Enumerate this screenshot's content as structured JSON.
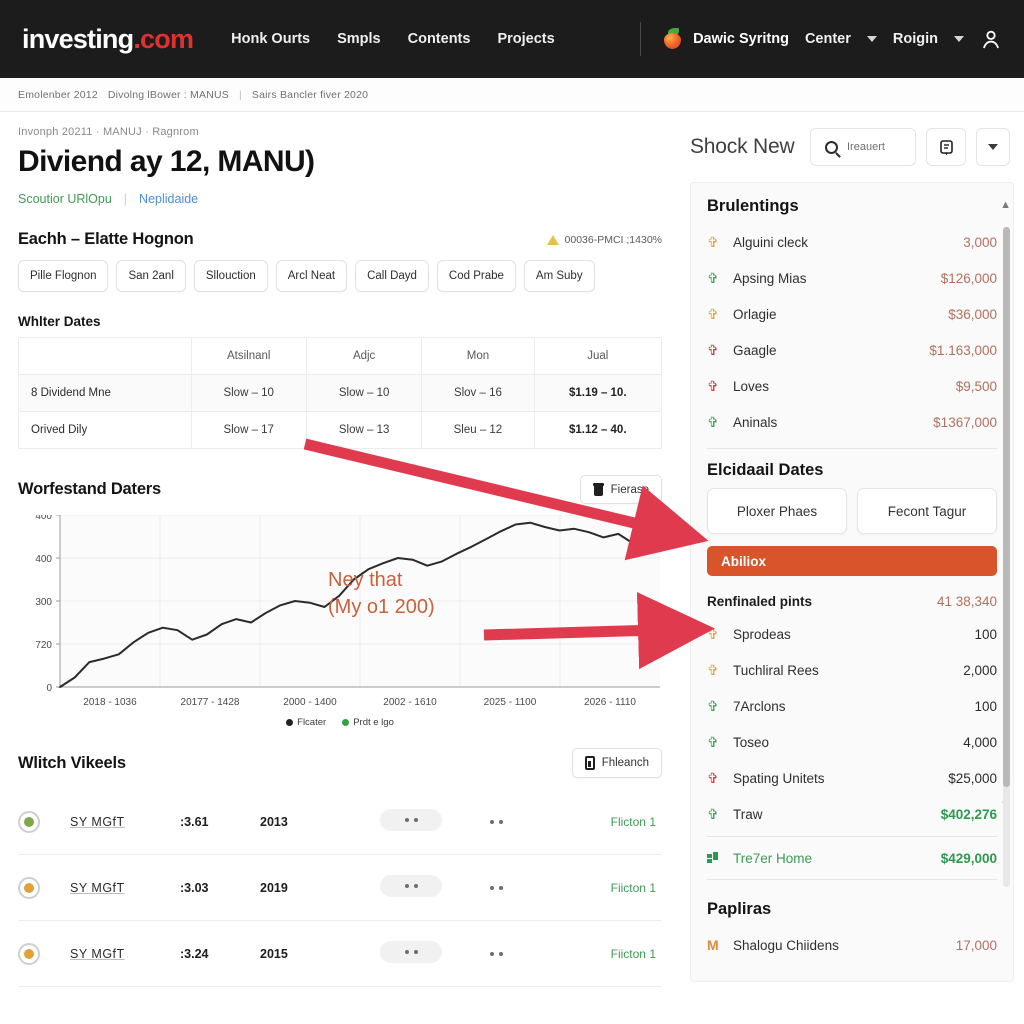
{
  "nav": {
    "logo_investing": "investing",
    "logo_com": ".com",
    "links": [
      "Honk Ourts",
      "Smpls",
      "Contents",
      "Projects"
    ],
    "user_name": "Dawic Syritng",
    "center_label": "Center",
    "region_label": "Roigin",
    "berry_icon": "berry-icon",
    "avatar_icon": "person-icon"
  },
  "crumbstrip": {
    "item1": "Emolenber 2012",
    "item2": "Divolng lBower : MANUS",
    "sep": "|",
    "item3": "Sairs Bancler fiver 2020"
  },
  "left": {
    "breadcrumb": "Invonph 20211  ·  MANUJ  ·  Ragnrom",
    "title": "Diviend ay 12, MANU)",
    "sublink_green": "Scoutior URlOpu",
    "sublink_sep": "|",
    "sublink_blue": "Neplidaide",
    "section_title": "Eachh – Elatte Hognon",
    "alert_text": "00036-PMCI ;1430%",
    "pills": [
      "Pille Flognon",
      "San 2anl",
      "Sllouction",
      "Arcl Neat",
      "Call Dayd",
      "Cod Prabe",
      "Am Suby"
    ],
    "table_title": "Whlter Dates",
    "table": {
      "headers": [
        "",
        "Atsilnanl",
        "Adjc",
        "Mon",
        "Jual"
      ],
      "rows": [
        [
          "8 Dividend Mne",
          "Slow – 10",
          "Slow – 10",
          "Slov – 16",
          "$1.19 – 10."
        ],
        [
          "Orived Dily",
          "Slow – 17",
          "Slow – 13",
          "Sleu – 12",
          "$1.12 – 40."
        ]
      ]
    },
    "chart_title": "Worfestand Daters",
    "chart_btn": "Fierase",
    "chart_btn_icon": "trash-icon",
    "list_title": "Wlitch Vikeels",
    "list_btn": "Fhleanch",
    "list_btn_icon": "battery-icon",
    "list_rows": [
      {
        "dot_color": "#7fa84a",
        "symbol": "SY MGfT",
        "a": ":3.61",
        "b": "2013",
        "right": "Flicton 1"
      },
      {
        "dot_color": "#dfa23a",
        "symbol": "SY MGfT",
        "a": ":3.03",
        "b": "2019",
        "right": "Fiicton 1"
      },
      {
        "dot_color": "#dfa23a",
        "symbol": "SY MGfT",
        "a": ":3.24",
        "b": "2015",
        "right": "Fiicton 1"
      }
    ]
  },
  "chart_data": {
    "type": "line",
    "title": "Worfestand Daters",
    "xlabel": "",
    "ylabel": "",
    "ylim": [
      0,
      400
    ],
    "yticks": [
      "400",
      "400",
      "300",
      "720",
      "0"
    ],
    "xticks": [
      "2018 - 1036",
      "20177 - 1428",
      "2000 - 1400",
      "2002 - 1610",
      "2025 - 1100",
      "2026 - 1110"
    ],
    "annotation": "Ney that\n(My o1 200)",
    "legend": [
      "Flcater",
      "Prdt e lgo"
    ],
    "legend_colors": [
      "#222222",
      "#2fa14b"
    ],
    "grid": true,
    "series": [
      {
        "name": "Flcater",
        "color": "#2b2b2b",
        "values": [
          0,
          22,
          58,
          66,
          76,
          104,
          126,
          138,
          132,
          110,
          122,
          146,
          158,
          150,
          172,
          190,
          200,
          196,
          186,
          212,
          250,
          274,
          288,
          300,
          296,
          282,
          292,
          310,
          326,
          344,
          362,
          378,
          382,
          372,
          364,
          368,
          360,
          348,
          356,
          334
        ]
      }
    ]
  },
  "right": {
    "panel_title": "Shock New",
    "search_placeholder": "Ireauert",
    "search_icon": "search-icon",
    "doc_icon": "document-icon",
    "chevron_icon": "chevron-down-icon",
    "section1_title": "Brulentings",
    "section1_rows": [
      {
        "icon_color": "#e0a23c",
        "name": "Alguini cleck",
        "value": "3,000"
      },
      {
        "icon_color": "#3aa350",
        "name": "Apsing Mias",
        "value": "$126,000"
      },
      {
        "icon_color": "#e0a23c",
        "name": "Orlagie",
        "value": "$36,000"
      },
      {
        "icon_color": "#cc3b3b",
        "name": "Gaagle",
        "value": "$1.163,000"
      },
      {
        "icon_color": "#cc3b3b",
        "name": "Loves",
        "value": "$9,500"
      },
      {
        "icon_color": "#3aa350",
        "name": "Aninals",
        "value": "$1367,000"
      }
    ],
    "section2_title": "Elcidaail Dates",
    "btn1": "Ploxer Phaes",
    "btn2": "Fecont Tagur",
    "bar_label": "Abiliox",
    "kv_key": "Renfinaled pints",
    "kv_value": "41 38,340",
    "section2_rows": [
      {
        "icon_color": "#e0a23c",
        "name": "Sprodeas",
        "value": "100"
      },
      {
        "icon_color": "#e0a23c",
        "name": "Tuchliral Rees",
        "value": "2,000"
      },
      {
        "icon_color": "#3aa350",
        "name": "7Arclons",
        "value": "100"
      },
      {
        "icon_color": "#3aa350",
        "name": "Toseo",
        "value": "4,000"
      },
      {
        "icon_color": "#cc3b3b",
        "name": "Spating Unitets",
        "value": "$25,000"
      },
      {
        "icon_color": "#3aa350",
        "name": "Traw",
        "value": "$402,276",
        "green": true
      }
    ],
    "total_icon": "grid-icon",
    "total_label": "Tre7er Home",
    "total_value": "$429,000",
    "section3_title": "Papliras",
    "section3_rows": [
      {
        "icon_letter": "M",
        "name": "Shalogu Chiidens",
        "value": "17,000"
      }
    ]
  },
  "annotations": {
    "arrow_color": "#e03a4e",
    "arrow1": "arrow-to-chart-header",
    "arrow2": "arrow-to-abiliox-bar"
  }
}
